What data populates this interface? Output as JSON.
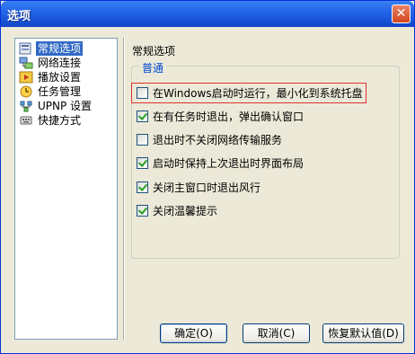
{
  "window": {
    "title": "选项",
    "close_label": "✕"
  },
  "nav": {
    "items": [
      {
        "label": "常规选项",
        "icon": "general-settings-icon",
        "selected": true
      },
      {
        "label": "网络连接",
        "icon": "network-connection-icon",
        "selected": false
      },
      {
        "label": "播放设置",
        "icon": "playback-settings-icon",
        "selected": false
      },
      {
        "label": "任务管理",
        "icon": "task-manager-icon",
        "selected": false
      },
      {
        "label": "UPNP 设置",
        "icon": "upnp-settings-icon",
        "selected": false
      },
      {
        "label": "快捷方式",
        "icon": "shortcut-icon",
        "selected": false
      }
    ]
  },
  "page": {
    "title": "常规选项",
    "group_title": "普通",
    "options": [
      {
        "label": "在Windows启动时运行，最小化到系统托盘",
        "checked": false
      },
      {
        "label": "在有任务时退出，弹出确认窗口",
        "checked": true
      },
      {
        "label": "退出时不关闭网络传输服务",
        "checked": false
      },
      {
        "label": "启动时保持上次退出时界面布局",
        "checked": true
      },
      {
        "label": "关闭主窗口时退出风行",
        "checked": true
      },
      {
        "label": "关闭温馨提示",
        "checked": true
      }
    ]
  },
  "buttons": {
    "ok": "确定(O)",
    "cancel": "取消(C)",
    "restore": "恢复默认值(D)"
  },
  "colors": {
    "highlight_border": "#e03030",
    "selection": "#316ac5",
    "group_title": "#0046d5"
  }
}
